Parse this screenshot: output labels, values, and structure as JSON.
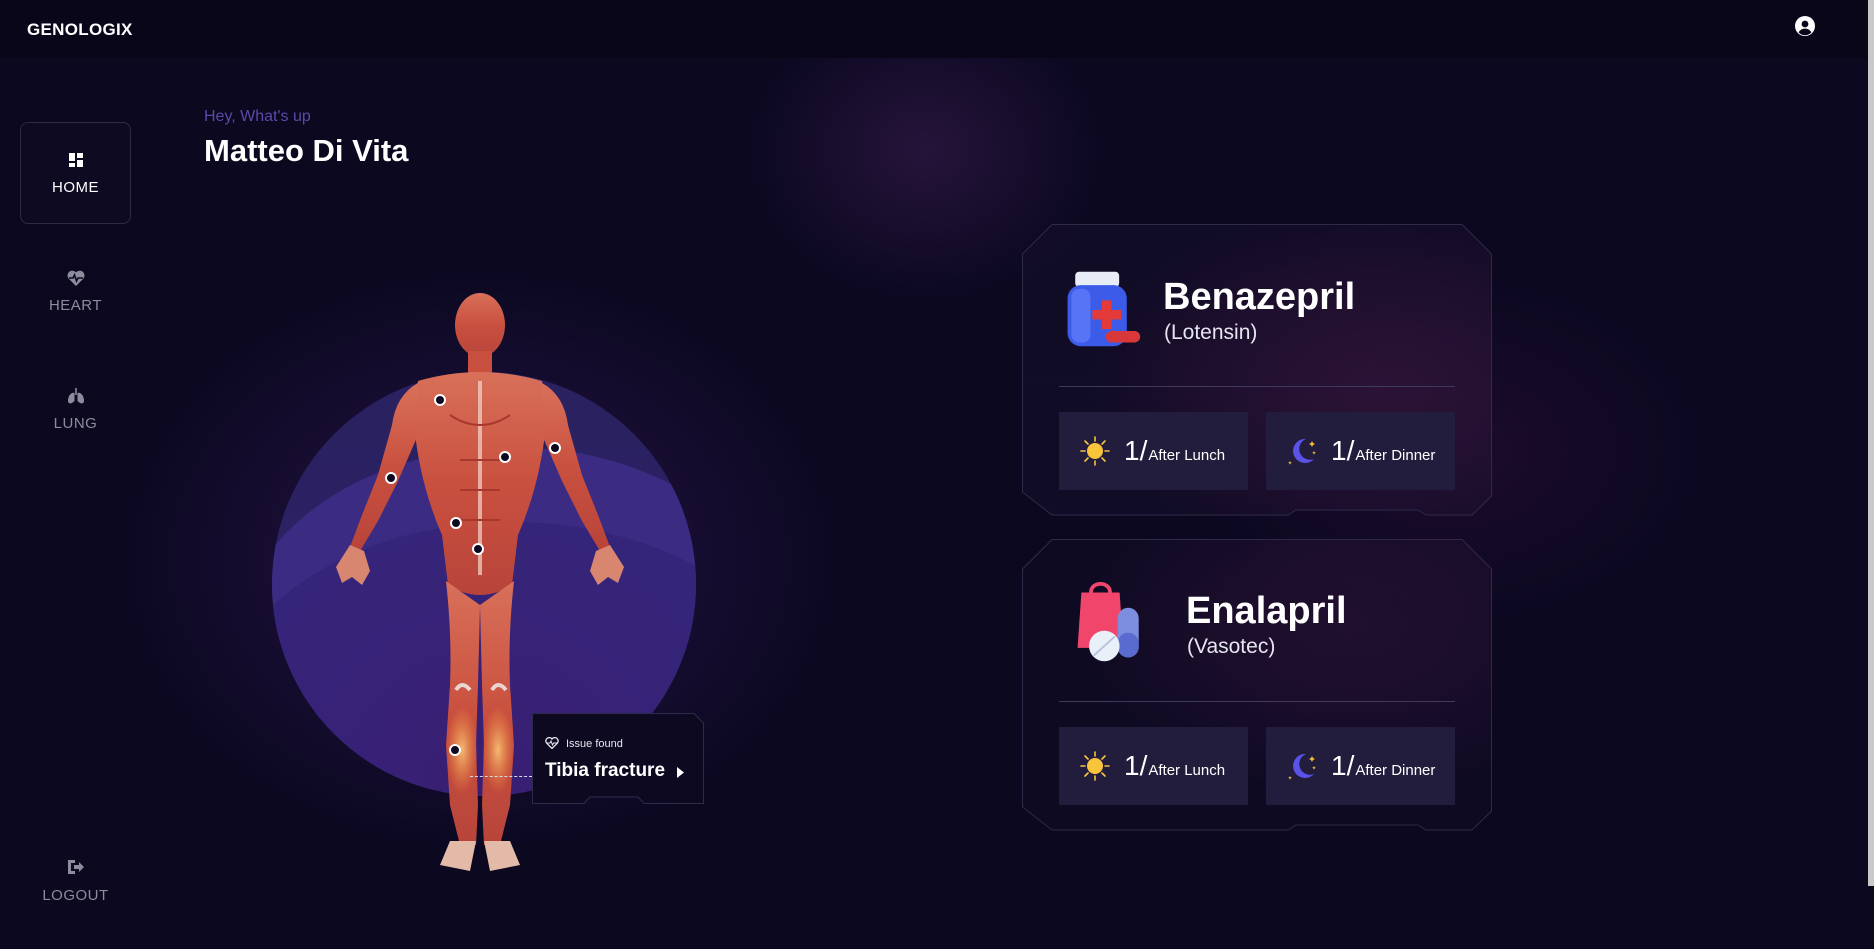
{
  "app": {
    "brand": "GENOLOGIX"
  },
  "header": {
    "user_icon": "user-circle-icon"
  },
  "sidebar": {
    "items": [
      {
        "label": "HOME",
        "icon": "dashboard-grid-icon",
        "active": true
      },
      {
        "label": "HEART",
        "icon": "heart-pulse-icon",
        "active": false
      },
      {
        "label": "LUNG",
        "icon": "lungs-icon",
        "active": false
      }
    ],
    "logout": {
      "label": "LOGOUT",
      "icon": "logout-icon"
    }
  },
  "greeting": {
    "subtitle": "Hey, What's up",
    "name": "Matteo Di Vita"
  },
  "body_map": {
    "image": "human-muscle-anatomy-figure",
    "issue": {
      "label": "Issue found",
      "title": "Tibia fracture",
      "icon": "heart-icon"
    }
  },
  "medications": [
    {
      "name": "Benazepril",
      "brand": "(Lotensin)",
      "icon": "pill-bottle-icon",
      "doses": [
        {
          "qty": "1",
          "when": "After Lunch",
          "icon": "sun-icon"
        },
        {
          "qty": "1",
          "when": "After Dinner",
          "icon": "moon-icon"
        }
      ]
    },
    {
      "name": "Enalapril",
      "brand": "(Vasotec)",
      "icon": "pills-bag-icon",
      "doses": [
        {
          "qty": "1",
          "when": "After Lunch",
          "icon": "sun-icon"
        },
        {
          "qty": "1",
          "when": "After Dinner",
          "icon": "moon-icon"
        }
      ]
    }
  ],
  "colors": {
    "background": "#0b0820",
    "accent": "#5d49a8",
    "dose_panel": "#231d3d",
    "card_border": "#2f2a4a"
  }
}
